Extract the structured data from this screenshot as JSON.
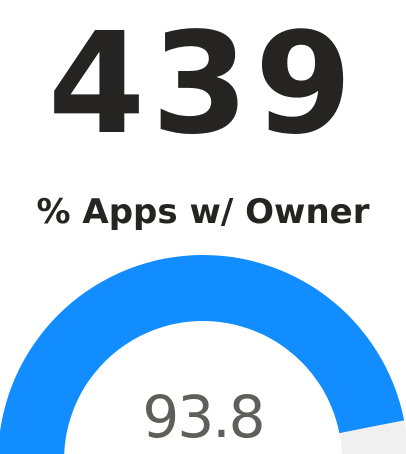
{
  "kpi": {
    "value": "439"
  },
  "chart_data": {
    "type": "gauge",
    "title": "% Apps w/ Owner",
    "value": 93.8,
    "value_label": "93.8",
    "min": 0,
    "max": 100,
    "colors": {
      "fill": "#118dff",
      "track": "#f0f0f0"
    }
  }
}
